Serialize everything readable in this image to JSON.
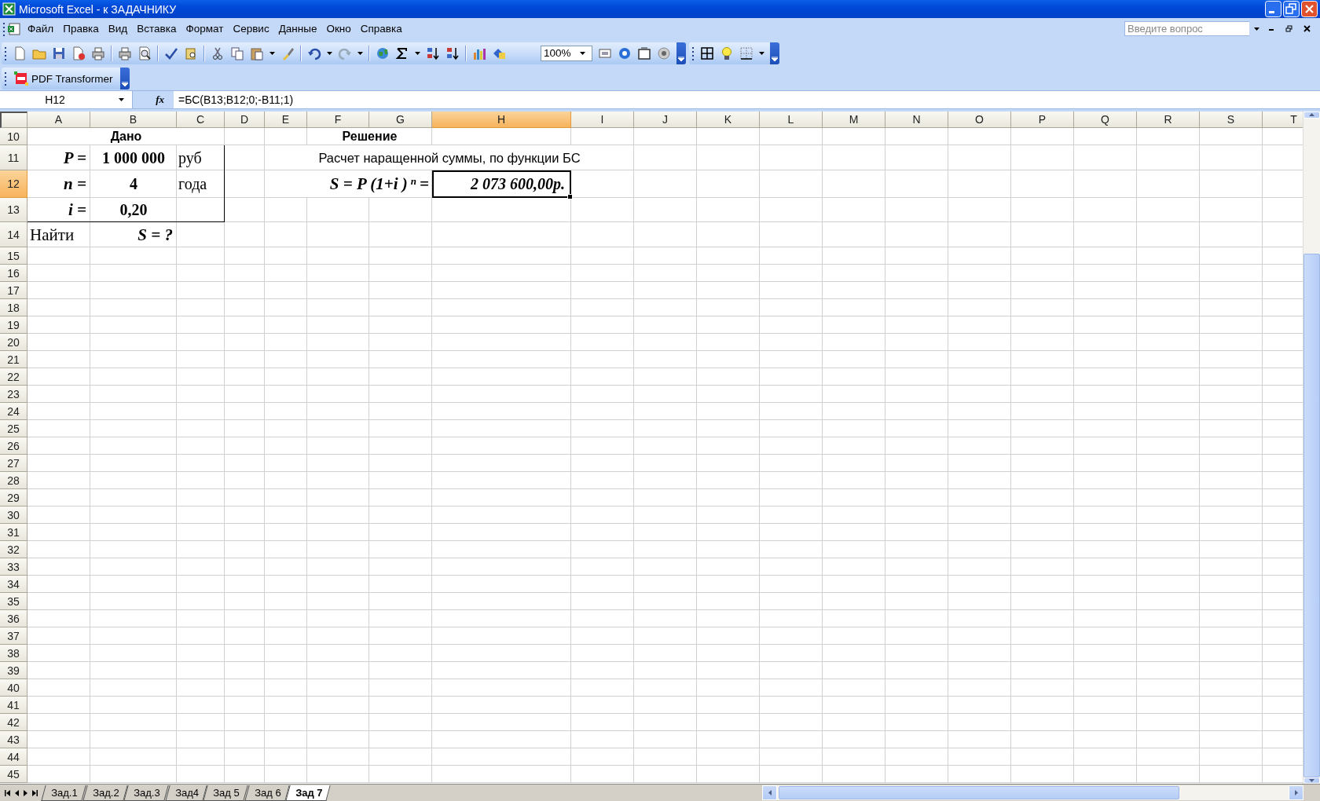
{
  "window": {
    "title": "Microsoft Excel - к ЗАДАЧНИКУ"
  },
  "menu": [
    "Файл",
    "Правка",
    "Вид",
    "Вставка",
    "Формат",
    "Сервис",
    "Данные",
    "Окно",
    "Справка"
  ],
  "help_search": {
    "placeholder": "Введите вопрос"
  },
  "toolbar": {
    "zoom": "100%"
  },
  "pdf_toolbar": {
    "label": "PDF Transformer"
  },
  "formula_bar": {
    "name_box": "H12",
    "function_button": "fx",
    "formula": "=БС(B13;B12;0;-B11;1)"
  },
  "sheet": {
    "columns": [
      {
        "label": "A",
        "selected": false
      },
      {
        "label": "B",
        "selected": false
      },
      {
        "label": "C",
        "selected": false
      },
      {
        "label": "D",
        "selected": false
      },
      {
        "label": "E",
        "selected": false
      },
      {
        "label": "F",
        "selected": false
      },
      {
        "label": "G",
        "selected": false
      },
      {
        "label": "H",
        "selected": true
      },
      {
        "label": "I",
        "selected": false
      },
      {
        "label": "J",
        "selected": false
      },
      {
        "label": "K",
        "selected": false
      },
      {
        "label": "L",
        "selected": false
      },
      {
        "label": "M",
        "selected": false
      },
      {
        "label": "N",
        "selected": false
      },
      {
        "label": "O",
        "selected": false
      },
      {
        "label": "P",
        "selected": false
      },
      {
        "label": "Q",
        "selected": false
      },
      {
        "label": "R",
        "selected": false
      },
      {
        "label": "S",
        "selected": false
      },
      {
        "label": "T",
        "selected": false
      }
    ],
    "rows": [
      {
        "label": "10",
        "selected": false
      },
      {
        "label": "11",
        "selected": false
      },
      {
        "label": "12",
        "selected": true
      },
      {
        "label": "13",
        "selected": false
      },
      {
        "label": "14",
        "selected": false
      },
      {
        "label": "15",
        "selected": false
      },
      {
        "label": "16",
        "selected": false
      },
      {
        "label": "17",
        "selected": false
      },
      {
        "label": "18",
        "selected": false
      },
      {
        "label": "19",
        "selected": false
      },
      {
        "label": "20",
        "selected": false
      },
      {
        "label": "21",
        "selected": false
      },
      {
        "label": "22",
        "selected": false
      },
      {
        "label": "23",
        "selected": false
      },
      {
        "label": "24",
        "selected": false
      },
      {
        "label": "25",
        "selected": false
      },
      {
        "label": "26",
        "selected": false
      },
      {
        "label": "27",
        "selected": false
      },
      {
        "label": "28",
        "selected": false
      },
      {
        "label": "29",
        "selected": false
      },
      {
        "label": "30",
        "selected": false
      },
      {
        "label": "31",
        "selected": false
      },
      {
        "label": "32",
        "selected": false
      },
      {
        "label": "33",
        "selected": false
      },
      {
        "label": "34",
        "selected": false
      },
      {
        "label": "35",
        "selected": false
      },
      {
        "label": "36",
        "selected": false
      },
      {
        "label": "37",
        "selected": false
      },
      {
        "label": "38",
        "selected": false
      },
      {
        "label": "39",
        "selected": false
      },
      {
        "label": "40",
        "selected": false
      },
      {
        "label": "41",
        "selected": false
      },
      {
        "label": "42",
        "selected": false
      },
      {
        "label": "43",
        "selected": false
      },
      {
        "label": "44",
        "selected": false
      },
      {
        "label": "45",
        "selected": false
      }
    ],
    "cells": [
      {
        "kind": "header",
        "text": "Дано",
        "selected": false
      },
      {
        "kind": "header",
        "text": "Решение",
        "selected": false
      },
      {
        "kind": "label",
        "text": "P =",
        "selected": false
      },
      {
        "kind": "value",
        "text": "1 000 000",
        "selected": false
      },
      {
        "kind": "unit",
        "text": "руб",
        "selected": false
      },
      {
        "kind": "text",
        "text": "Расчет наращенной суммы, по функции БС",
        "selected": false
      },
      {
        "kind": "label",
        "text": "n =",
        "selected": false
      },
      {
        "kind": "value",
        "text": "4",
        "selected": false
      },
      {
        "kind": "unit",
        "text": "года",
        "selected": false
      },
      {
        "kind": "formula",
        "text": "S = P (1+i ) $^{n}$ =",
        "selected": false
      },
      {
        "kind": "result",
        "text": "2 073 600,00р.",
        "selected": true
      },
      {
        "kind": "label",
        "text": "i =",
        "selected": false
      },
      {
        "kind": "value",
        "text": "0,20",
        "selected": false
      },
      {
        "kind": "note",
        "text": "Найти",
        "selected": false
      },
      {
        "kind": "label",
        "text": "S  = ?",
        "selected": false
      }
    ]
  },
  "sheet_tabs": [
    {
      "label": "Зад.1",
      "selected": false
    },
    {
      "label": "Зад.2",
      "selected": false
    },
    {
      "label": "Зад.3",
      "selected": false
    },
    {
      "label": "Зад4",
      "selected": false
    },
    {
      "label": "Зад 5",
      "selected": false
    },
    {
      "label": "Зад 6",
      "selected": false
    },
    {
      "label": "Зад 7",
      "selected": true
    }
  ]
}
